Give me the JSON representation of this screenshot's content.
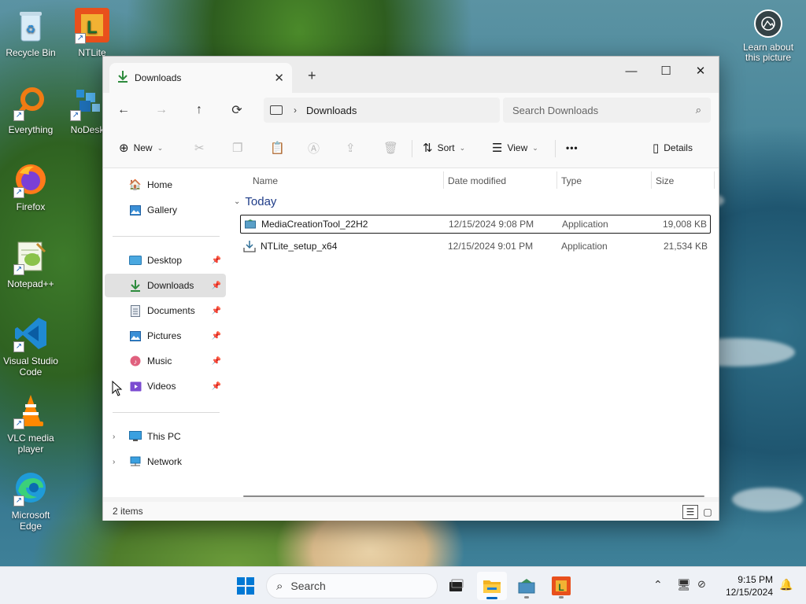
{
  "desktop": {
    "icons": [
      {
        "label": "Recycle Bin"
      },
      {
        "label": "NTLite"
      },
      {
        "label": "Everything"
      },
      {
        "label": "NoDesk"
      },
      {
        "label": "Firefox"
      },
      {
        "label": "Notepad++"
      },
      {
        "label": "Visual Studio Code"
      },
      {
        "label": "VLC media player"
      },
      {
        "label": "Microsoft Edge"
      }
    ],
    "learn_about": "Learn about this picture"
  },
  "window": {
    "tab": {
      "label": "Downloads"
    },
    "controls": {
      "minimize": "—",
      "maximize": "☐",
      "close": "✕"
    },
    "address": {
      "crumb": "Downloads"
    },
    "search": {
      "placeholder": "Search Downloads"
    },
    "commands": {
      "new": "New",
      "sort": "Sort",
      "view": "View",
      "more": "•••",
      "details": "Details"
    },
    "sidebar": {
      "home": "Home",
      "gallery": "Gallery",
      "desktop": "Desktop",
      "downloads": "Downloads",
      "documents": "Documents",
      "pictures": "Pictures",
      "music": "Music",
      "videos": "Videos",
      "this_pc": "This PC",
      "network": "Network"
    },
    "columns": {
      "name": "Name",
      "date": "Date modified",
      "type": "Type",
      "size": "Size"
    },
    "group": "Today",
    "files": [
      {
        "name": "MediaCreationTool_22H2",
        "date": "12/15/2024 9:08 PM",
        "type": "Application",
        "size": "19,008 KB"
      },
      {
        "name": "NTLite_setup_x64",
        "date": "12/15/2024 9:01 PM",
        "type": "Application",
        "size": "21,534 KB"
      }
    ],
    "status": "2 items"
  },
  "taskbar": {
    "search_label": "Search",
    "time": "9:15 PM",
    "date": "12/15/2024"
  },
  "colors": {
    "accent": "#0067c0",
    "folder_green": "#2e8b3d"
  }
}
